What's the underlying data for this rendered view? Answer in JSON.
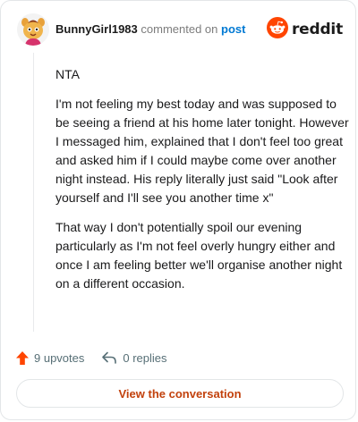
{
  "header": {
    "username": "BunnyGirl1983",
    "commented_text": "commented on",
    "post_link": "post",
    "logo_text": "reddit"
  },
  "comment": {
    "paragraphs": [
      "NTA",
      "I'm not feeling my best today and was supposed to be seeing a friend at his home later tonight. However I messaged him, explained that I don't feel too great and asked him if I could maybe come over another night instead. His reply literally just said \"Look after yourself and I'll see you another time x\"",
      "That way I don't potentially spoil our evening particularly as I'm not feel overly hungry either and once I am feeling better we'll organise another night on a different occasion."
    ]
  },
  "actions": {
    "upvotes": "9 upvotes",
    "replies": "0 replies"
  },
  "footer": {
    "view_button": "View the conversation"
  },
  "colors": {
    "brand_orange": "#ff4500",
    "link_blue": "#0079d3",
    "button_text": "#c2410c"
  },
  "icons": {
    "upvote": "upvote-arrow-icon",
    "reply": "reply-arrow-icon",
    "logo": "reddit-snoo-icon"
  }
}
